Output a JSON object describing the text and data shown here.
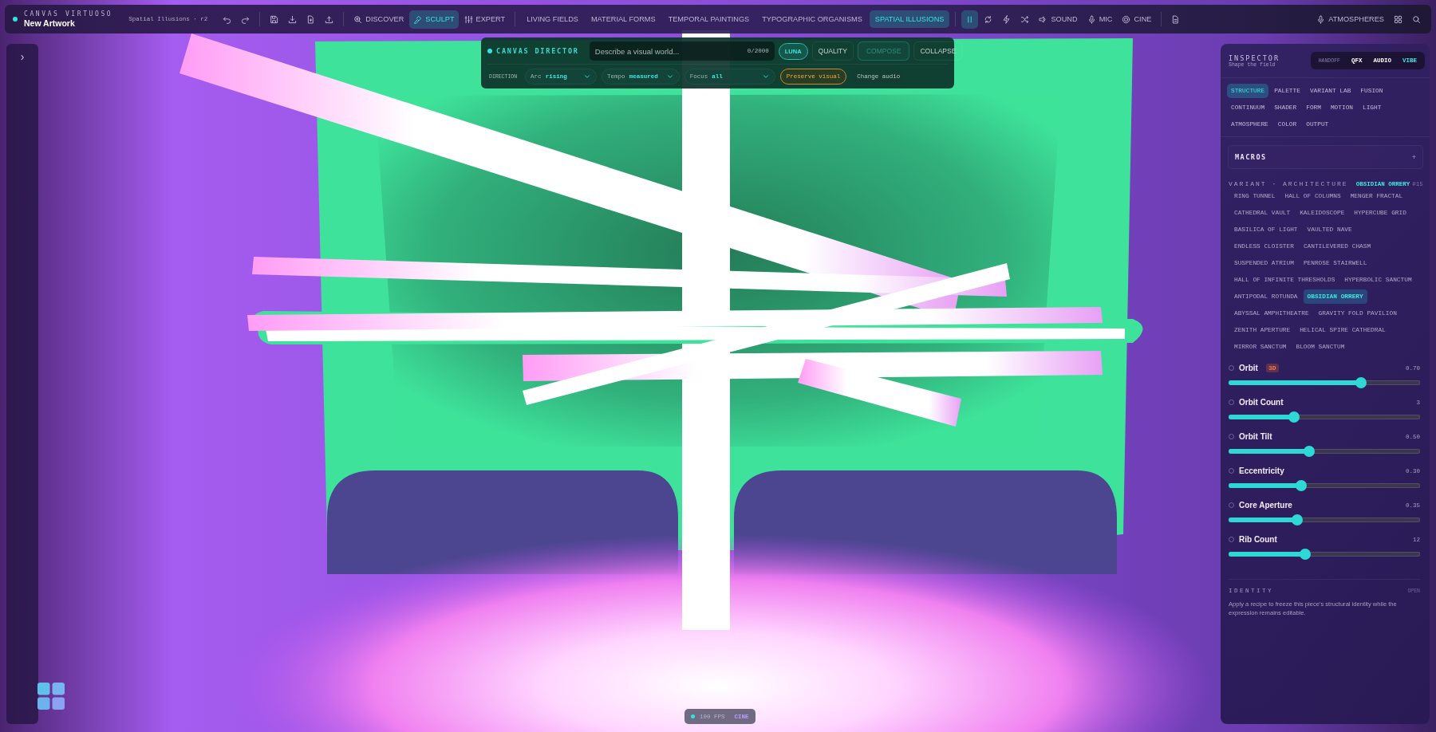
{
  "app": {
    "name": "CANVAS VIRTUOSO",
    "document": "New Artwork",
    "subtitle": "Spatial Illusions · r2"
  },
  "toolbar": {
    "modes": [
      {
        "label": "DISCOVER",
        "selected": false
      },
      {
        "label": "SCULPT",
        "selected": true
      },
      {
        "label": "EXPERT",
        "selected": false
      }
    ],
    "categories": [
      {
        "label": "LIVING FIELDS",
        "selected": false
      },
      {
        "label": "MATERIAL FORMS",
        "selected": false
      },
      {
        "label": "TEMPORAL PAINTINGS",
        "selected": false
      },
      {
        "label": "TYPOGRAPHIC ORGANISMS",
        "selected": false
      },
      {
        "label": "SPATIAL ILLUSIONS",
        "selected": true
      }
    ],
    "playing": true,
    "toggles": [
      {
        "label": "SOUND"
      },
      {
        "label": "MIC"
      },
      {
        "label": "CINE"
      }
    ],
    "atmospheres": "ATMOSPHERES"
  },
  "rail": {
    "toggle": "›"
  },
  "director": {
    "title": "CANVAS DIRECTOR",
    "prompt_placeholder": "Describe a visual world...",
    "counter": "0/2000",
    "buttons": [
      {
        "label": "LUNA",
        "selected": true,
        "disabled": false
      },
      {
        "label": "QUALITY",
        "selected": false,
        "disabled": false
      },
      {
        "label": "COMPOSE",
        "selected": false,
        "disabled": true
      },
      {
        "label": "COLLAPSE",
        "selected": false,
        "disabled": false
      }
    ],
    "direction_label": "DIRECTION",
    "selects": [
      {
        "label": "Arc",
        "value": "rising"
      },
      {
        "label": "Tempo",
        "value": "measured"
      },
      {
        "label": "Focus",
        "value": "all"
      }
    ],
    "chips": [
      {
        "label": "Preserve visual",
        "selected": true
      },
      {
        "label": "Change audio",
        "selected": false
      }
    ]
  },
  "inspector": {
    "title": "INSPECTOR",
    "subtitle": "Shape the field",
    "modes": [
      {
        "label": "HANDOFF",
        "selected": false,
        "disabled": true
      },
      {
        "label": "QFX",
        "selected": false,
        "disabled": false
      },
      {
        "label": "AUDIO",
        "selected": false,
        "disabled": false
      },
      {
        "label": "VIBE",
        "selected": true,
        "disabled": false
      }
    ],
    "tabs": [
      {
        "label": "STRUCTURE",
        "selected": true
      },
      {
        "label": "PALETTE",
        "selected": false
      },
      {
        "label": "VARIANT LAB",
        "selected": false
      },
      {
        "label": "FUSION",
        "selected": false
      },
      {
        "label": "CONTINUUM",
        "selected": false
      },
      {
        "label": "SHADER",
        "selected": false
      },
      {
        "label": "FORM",
        "selected": false
      },
      {
        "label": "MOTION",
        "selected": false
      },
      {
        "label": "LIGHT",
        "selected": false
      },
      {
        "label": "ATMOSPHERE",
        "selected": false
      },
      {
        "label": "COLOR",
        "selected": false
      },
      {
        "label": "OUTPUT",
        "selected": false
      }
    ],
    "macros": {
      "title": "MACROS",
      "expanded": false,
      "toggle": "+"
    },
    "variant": {
      "title": "VARIANT · ARCHITECTURE",
      "current": "OBSIDIAN ORRERY",
      "index": "#15",
      "options": [
        {
          "label": "RING TUNNEL",
          "selected": false
        },
        {
          "label": "HALL OF COLUMNS",
          "selected": false
        },
        {
          "label": "MENGER FRACTAL",
          "selected": false
        },
        {
          "label": "CATHEDRAL VAULT",
          "selected": false
        },
        {
          "label": "KALEIDOSCOPE",
          "selected": false
        },
        {
          "label": "HYPERCUBE GRID",
          "selected": false
        },
        {
          "label": "BASILICA OF LIGHT",
          "selected": false
        },
        {
          "label": "VAULTED NAVE",
          "selected": false
        },
        {
          "label": "ENDLESS CLOISTER",
          "selected": false
        },
        {
          "label": "CANTILEVERED CHASM",
          "selected": false
        },
        {
          "label": "SUSPENDED ATRIUM",
          "selected": false
        },
        {
          "label": "PENROSE STAIRWELL",
          "selected": false
        },
        {
          "label": "HALL OF INFINITE THRESHOLDS",
          "selected": false
        },
        {
          "label": "HYPERBOLIC SANCTUM",
          "selected": false
        },
        {
          "label": "ANTIPODAL ROTUNDA",
          "selected": false
        },
        {
          "label": "OBSIDIAN ORRERY",
          "selected": true
        },
        {
          "label": "ABYSSAL AMPHITHEATRE",
          "selected": false
        },
        {
          "label": "GRAVITY FOLD PAVILION",
          "selected": false
        },
        {
          "label": "ZENITH APERTURE",
          "selected": false
        },
        {
          "label": "HELICAL SPIRE CATHEDRAL",
          "selected": false
        },
        {
          "label": "MIRROR SANCTUM",
          "selected": false
        },
        {
          "label": "BLOOM SANCTUM",
          "selected": false
        }
      ]
    },
    "sliders": [
      {
        "label": "Orbit",
        "badge": "3D",
        "value": "0.70",
        "level": 0.69
      },
      {
        "label": "Orbit Count",
        "value": "3",
        "level": 0.34
      },
      {
        "label": "Orbit Tilt",
        "value": "0.50",
        "level": 0.42
      },
      {
        "label": "Eccentricity",
        "value": "0.30",
        "level": 0.38
      },
      {
        "label": "Core Aperture",
        "value": "0.35",
        "level": 0.36
      },
      {
        "label": "Rib Count",
        "value": "12",
        "level": 0.4
      }
    ],
    "identity": {
      "title": "IDENTITY",
      "action": "OPEN",
      "text": "Apply a recipe to freeze this piece's structural identity while the expression remains editable."
    }
  },
  "fps": {
    "reading": "100 FPS",
    "mode": "CINE"
  }
}
